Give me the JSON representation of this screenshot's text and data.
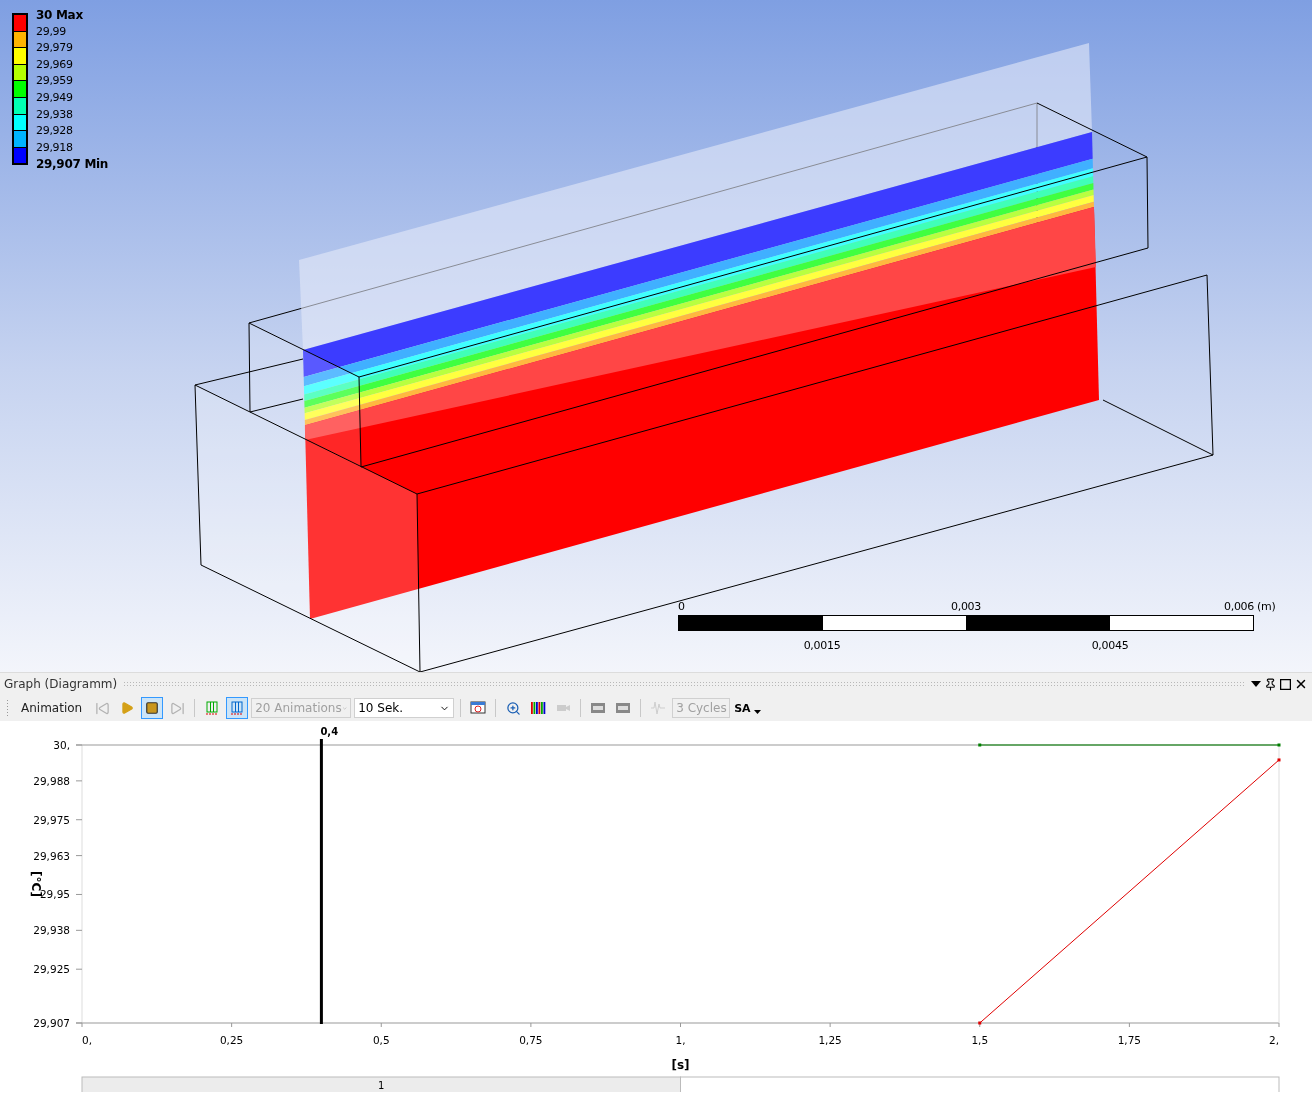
{
  "legend": {
    "labels": [
      "30 Max",
      "29,99",
      "29,979",
      "29,969",
      "29,959",
      "29,949",
      "29,938",
      "29,928",
      "29,918",
      "29,907 Min"
    ],
    "bands": [
      {
        "color": "#ff0000"
      },
      {
        "color": "#ffb400"
      },
      {
        "color": "#ffff00"
      },
      {
        "color": "#b4ff00"
      },
      {
        "color": "#00ff00"
      },
      {
        "color": "#00ffb4"
      },
      {
        "color": "#00ffff"
      },
      {
        "color": "#00b4ff"
      },
      {
        "color": "#0000ff"
      }
    ]
  },
  "scale_bar": {
    "top_labels": [
      "0",
      "0,003",
      "0,006"
    ],
    "unit": "(m)",
    "bottom_labels": [
      "0,0015",
      "0,0045"
    ]
  },
  "panel": {
    "title": "Graph (Diagramm)"
  },
  "toolbar": {
    "label": "Animation",
    "buttons": [
      {
        "kind": "first",
        "selected": false,
        "disabled": true
      },
      {
        "kind": "play",
        "selected": false,
        "disabled": false
      },
      {
        "kind": "stop",
        "selected": true,
        "disabled": false
      },
      {
        "kind": "last",
        "selected": false,
        "disabled": true
      },
      {
        "kind": "graph-a",
        "selected": false,
        "disabled": false
      },
      {
        "kind": "graph-b",
        "selected": true,
        "disabled": false
      }
    ],
    "frames": {
      "value": "20 Animations",
      "disabled": true
    },
    "duration": {
      "value": "10 Sek.",
      "disabled": false
    },
    "tools": [
      {
        "kind": "export",
        "disabled": false
      },
      {
        "kind": "zoom",
        "disabled": false
      },
      {
        "kind": "colors",
        "disabled": false
      },
      {
        "kind": "camera",
        "disabled": true
      },
      {
        "kind": "film-a",
        "disabled": false
      },
      {
        "kind": "film-b",
        "disabled": false
      },
      {
        "kind": "wave",
        "disabled": true
      }
    ],
    "cycles": {
      "value": "3 Cycles",
      "disabled": true
    },
    "mode": "SA"
  },
  "graph": {
    "timeline_label": "1",
    "chart_data": {
      "type": "line",
      "xlabel": "[s]",
      "ylabel": "[°C]",
      "xlim": [
        0,
        2
      ],
      "ylim": [
        29.907,
        30
      ],
      "xticks": [
        {
          "value": 0,
          "label": "0,"
        },
        {
          "value": 0.25,
          "label": "0,25"
        },
        {
          "value": 0.5,
          "label": "0,5"
        },
        {
          "value": 0.75,
          "label": "0,75"
        },
        {
          "value": 1,
          "label": "1,"
        },
        {
          "value": 1.25,
          "label": "1,25"
        },
        {
          "value": 1.5,
          "label": "1,5"
        },
        {
          "value": 1.75,
          "label": "1,75"
        },
        {
          "value": 2,
          "label": "2,"
        }
      ],
      "yticks": [
        {
          "value": 29.907,
          "label": "29,907"
        },
        {
          "value": 29.925,
          "label": "29,925"
        },
        {
          "value": 29.938,
          "label": "29,938"
        },
        {
          "value": 29.95,
          "label": "29,95"
        },
        {
          "value": 29.963,
          "label": "29,963"
        },
        {
          "value": 29.975,
          "label": "29,975"
        },
        {
          "value": 29.988,
          "label": "29,988"
        },
        {
          "value": 30,
          "label": "30,"
        }
      ],
      "x": [
        1.5,
        2
      ],
      "series": [
        {
          "color": "#008000",
          "marker": "square",
          "values": [
            30,
            30
          ]
        },
        {
          "color": "#e00000",
          "marker": "square",
          "values": [
            29.907,
            29.995
          ]
        }
      ],
      "ref_lines": [
        {
          "axis": "x",
          "value": 0.4,
          "label": "0,4"
        }
      ]
    }
  }
}
